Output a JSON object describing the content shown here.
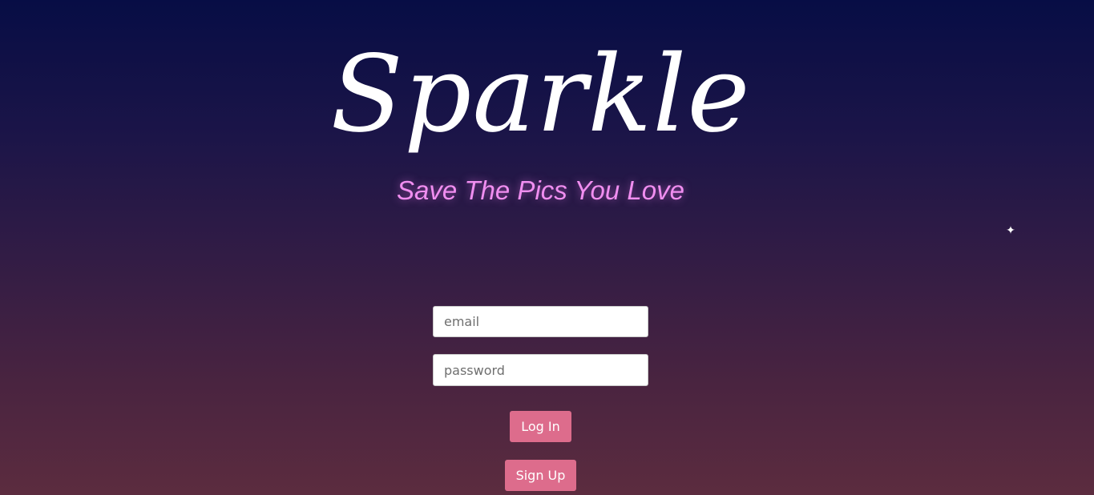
{
  "header": {
    "logo_text": "Sparkle",
    "tagline": "Save The Pics You Love"
  },
  "decor": {
    "sparkle_glyph": "✦",
    "sparkle_icon": "sparkle-icon"
  },
  "form": {
    "email_placeholder": "email",
    "password_placeholder": "password",
    "login_label": "Log In",
    "signup_label": "Sign Up"
  },
  "colors": {
    "background_top": "#070d45",
    "background_bottom": "#5c2c3f",
    "tagline": "#f08ef0",
    "button": "#dd6c8c",
    "logo": "#ffffff"
  }
}
